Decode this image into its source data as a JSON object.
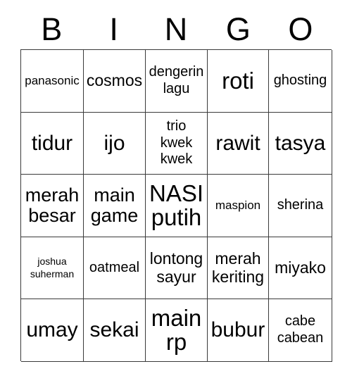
{
  "card": {
    "type": "bingo-card",
    "header": {
      "letters": [
        "B",
        "I",
        "N",
        "G",
        "O"
      ]
    },
    "grid": {
      "columns": 5,
      "rows": 5,
      "cells": [
        [
          {
            "text": "panasonic",
            "size": "s-sm"
          },
          {
            "text": "cosmos",
            "size": "s-lg"
          },
          {
            "text": "dengerin\nlagu",
            "size": "s-md"
          },
          {
            "text": "roti",
            "size": "s-xxxl"
          },
          {
            "text": "ghosting",
            "size": "s-md"
          }
        ],
        [
          {
            "text": "tidur",
            "size": "s-xxl"
          },
          {
            "text": "ijo",
            "size": "s-xxl"
          },
          {
            "text": "trio\nkwek\nkwek",
            "size": "s-md"
          },
          {
            "text": "rawit",
            "size": "s-xxl"
          },
          {
            "text": "tasya",
            "size": "s-xxl"
          }
        ],
        [
          {
            "text": "merah\nbesar",
            "size": "s-xl"
          },
          {
            "text": "main\ngame",
            "size": "s-xl"
          },
          {
            "text": "NASI\nputih",
            "size": "s-xxxl"
          },
          {
            "text": "maspion",
            "size": "s-sm"
          },
          {
            "text": "sherina",
            "size": "s-md"
          }
        ],
        [
          {
            "text": "joshua\nsuherman",
            "size": "s-xs"
          },
          {
            "text": "oatmeal",
            "size": "s-md"
          },
          {
            "text": "lontong\nsayur",
            "size": "s-lg"
          },
          {
            "text": "merah\nkeriting",
            "size": "s-lg"
          },
          {
            "text": "miyako",
            "size": "s-lg"
          }
        ],
        [
          {
            "text": "umay",
            "size": "s-xxl"
          },
          {
            "text": "sekai",
            "size": "s-xxl"
          },
          {
            "text": "main\nrp",
            "size": "s-xxxl"
          },
          {
            "text": "bubur",
            "size": "s-xxl"
          },
          {
            "text": "cabe\ncabean",
            "size": "s-md"
          }
        ]
      ]
    },
    "colors": {
      "background": "#ffffff",
      "text": "#000000",
      "grid_line": "#3a3a3a"
    }
  }
}
